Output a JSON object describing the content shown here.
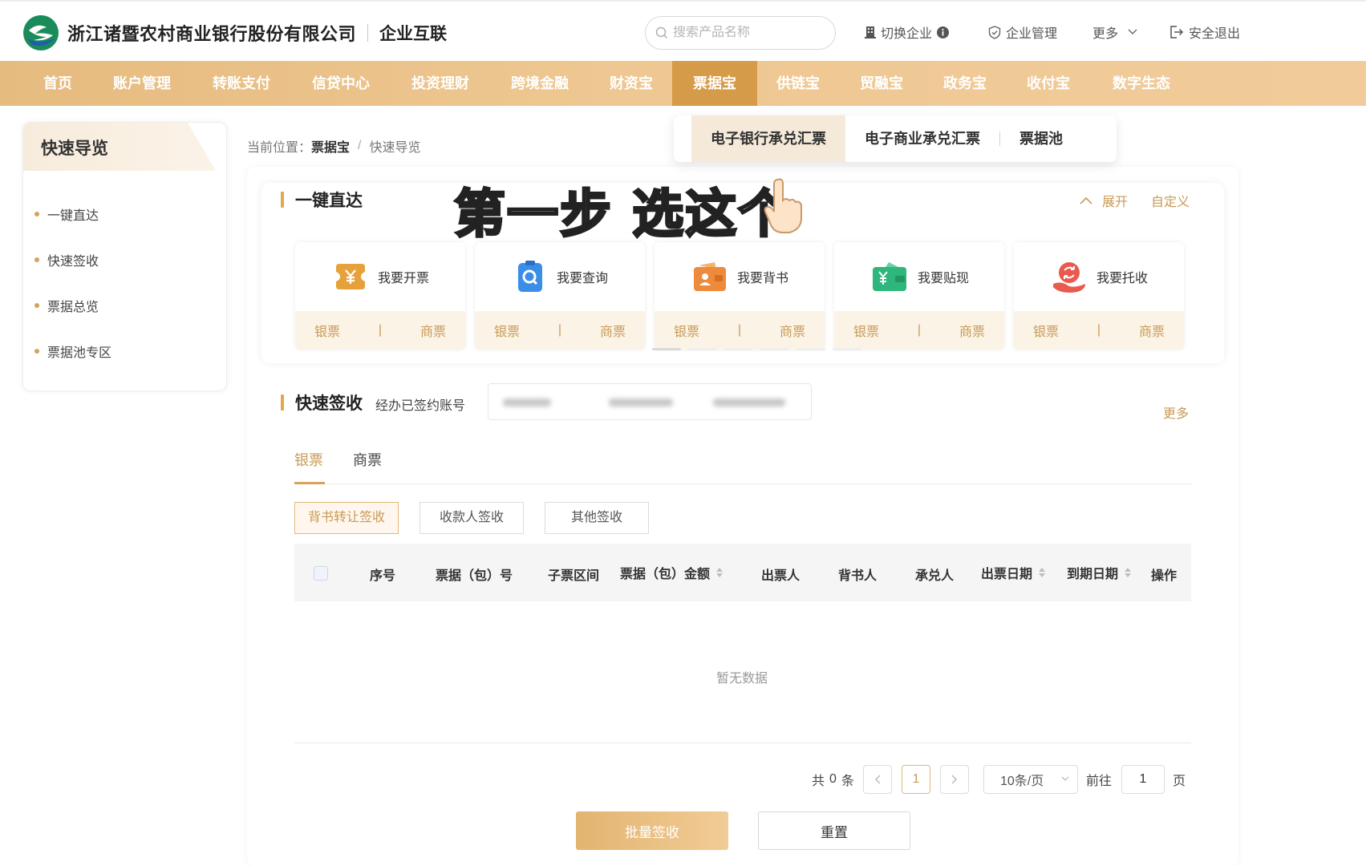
{
  "header": {
    "bank_name": "浙江诸暨农村商业银行股份有限公司",
    "portal_name": "企业互联",
    "search_placeholder": "搜索产品名称",
    "switch_company": "切换企业",
    "company_manage": "企业管理",
    "more": "更多",
    "logout": "安全退出"
  },
  "nav": {
    "items": [
      "首页",
      "账户管理",
      "转账支付",
      "信贷中心",
      "投资理财",
      "跨境金融",
      "财资宝",
      "票据宝",
      "供链宝",
      "贸融宝",
      "政务宝",
      "收付宝",
      "数字生态"
    ],
    "active": "票据宝"
  },
  "submenu": {
    "items": [
      "电子银行承兑汇票",
      "电子商业承兑汇票",
      "票据池"
    ],
    "active": "电子银行承兑汇票"
  },
  "sidebar": {
    "title": "快速导览",
    "items": [
      "一键直达",
      "快速签收",
      "票据总览",
      "票据池专区"
    ]
  },
  "breadcrumb": {
    "prefix": "当前位置：",
    "section": "票据宝",
    "separator": "/",
    "page": "快速导览"
  },
  "quick_access": {
    "title": "一键直达",
    "expand": "展开",
    "customize": "自定义",
    "annotation": "第一步 选这个",
    "cards": [
      {
        "label": "我要开票",
        "icon": "issue-bill-icon",
        "color": "#e7a13a",
        "links": [
          "银票",
          "商票"
        ]
      },
      {
        "label": "我要查询",
        "icon": "query-icon",
        "color": "#3b8ee8",
        "links": [
          "银票",
          "商票"
        ]
      },
      {
        "label": "我要背书",
        "icon": "endorse-icon",
        "color": "#ee8a3c",
        "links": [
          "银票",
          "商票"
        ]
      },
      {
        "label": "我要贴现",
        "icon": "discount-icon",
        "color": "#2fb67c",
        "links": [
          "银票",
          "商票"
        ]
      },
      {
        "label": "我要托收",
        "icon": "collection-icon",
        "color": "#e85b4e",
        "links": [
          "银票",
          "商票"
        ]
      }
    ]
  },
  "signing": {
    "title": "快速签收",
    "account_label": "经办已签约账号",
    "more": "更多",
    "tabs": [
      "银票",
      "商票"
    ],
    "active_tab": "银票",
    "filters": [
      "背书转让签收",
      "收款人签收",
      "其他签收"
    ],
    "active_filter": "背书转让签收",
    "columns": [
      "序号",
      "票据（包）号",
      "子票区间",
      "票据（包）金额",
      "出票人",
      "背书人",
      "承兑人",
      "出票日期",
      "到期日期",
      "操作"
    ],
    "empty_text": "暂无数据"
  },
  "pagination": {
    "total_prefix": "共",
    "total": "0",
    "total_suffix": "条",
    "current_page": "1",
    "page_size": "10条/页",
    "goto_label": "前往",
    "goto_value": "1",
    "goto_suffix": "页"
  },
  "actions": {
    "batch_sign": "批量签收",
    "reset": "重置"
  },
  "colors": {
    "accent": "#d59b48",
    "nav_gradient_start": "#e6bb7f",
    "gold_text": "#c99a56"
  }
}
